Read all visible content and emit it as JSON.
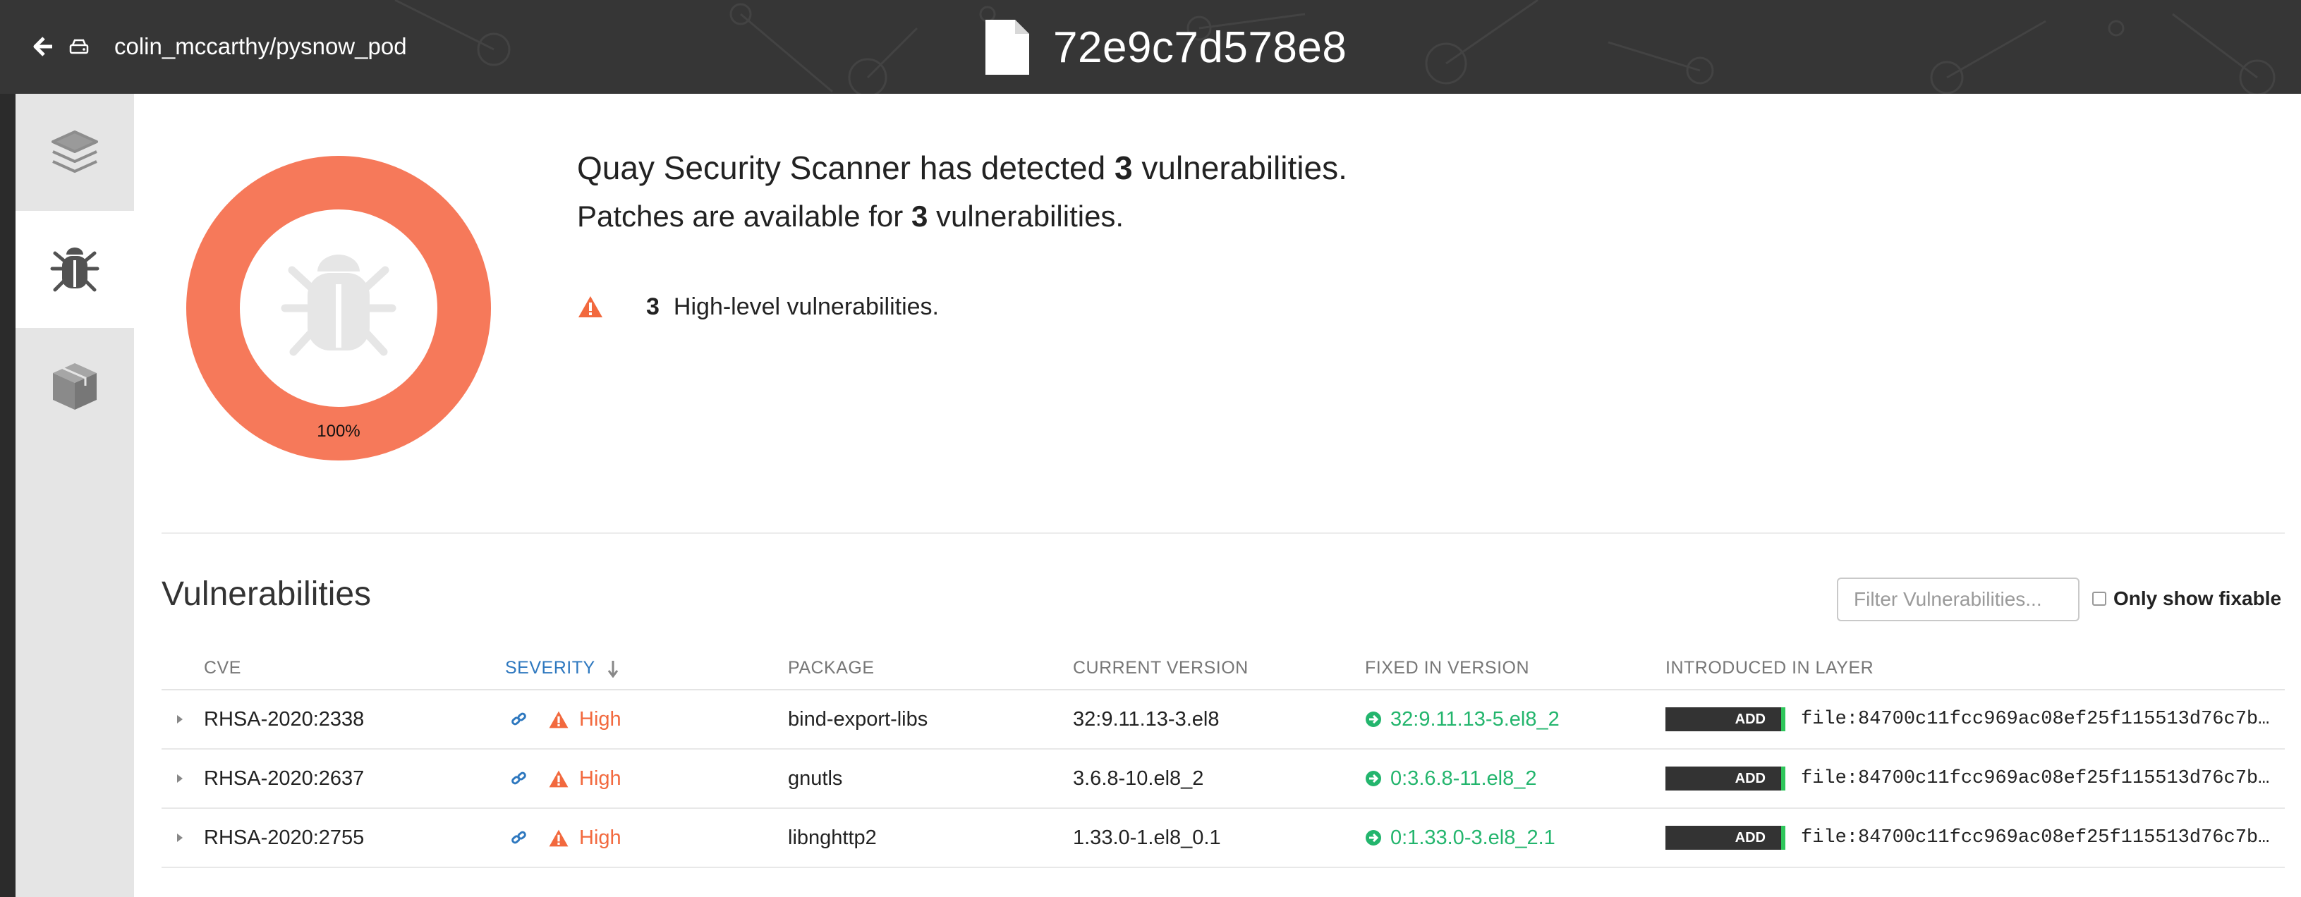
{
  "header": {
    "repository": "colin_mccarthy/pysnow_pod",
    "image_id": "72e9c7d578e8"
  },
  "sidebar": {
    "items": [
      {
        "icon": "layers-icon",
        "label": "Layers"
      },
      {
        "icon": "bug-icon",
        "label": "Security Scan",
        "active": true
      },
      {
        "icon": "package-icon",
        "label": "Packages"
      }
    ]
  },
  "summary": {
    "detected_prefix": "Quay Security Scanner has detected ",
    "detected_count": "3",
    "detected_suffix": " vulnerabilities.",
    "patches_prefix": "Patches are available for ",
    "patches_count": "3",
    "patches_suffix": " vulnerabilities.",
    "high_count": "3",
    "high_label": "High-level vulnerabilities."
  },
  "chart_data": {
    "type": "pie",
    "categories": [
      "High"
    ],
    "values": [
      100
    ],
    "labels": [
      "100%"
    ],
    "center_icon": "bug-icon"
  },
  "vulnerabilities": {
    "title": "Vulnerabilities",
    "filter_placeholder": "Filter Vulnerabilities...",
    "fixable_label": "Only show fixable",
    "columns": [
      "CVE",
      "SEVERITY",
      "PACKAGE",
      "CURRENT VERSION",
      "FIXED IN VERSION",
      "INTRODUCED IN LAYER"
    ],
    "sorted_column": "SEVERITY",
    "rows": [
      {
        "cve": "RHSA-2020:2338",
        "severity": "High",
        "package": "bind-export-libs",
        "current": "32:9.11.13-3.el8",
        "fixed": "32:9.11.13-5.el8_2",
        "layer_badge": "ADD",
        "layer": "file:84700c11fcc969ac08ef25f115513d76c7b…"
      },
      {
        "cve": "RHSA-2020:2637",
        "severity": "High",
        "package": "gnutls",
        "current": "3.6.8-10.el8_2",
        "fixed": "0:3.6.8-11.el8_2",
        "layer_badge": "ADD",
        "layer": "file:84700c11fcc969ac08ef25f115513d76c7b…"
      },
      {
        "cve": "RHSA-2020:2755",
        "severity": "High",
        "package": "libnghttp2",
        "current": "1.33.0-1.el8_0.1",
        "fixed": "0:1.33.0-3.el8_2.1",
        "layer_badge": "ADD",
        "layer": "file:84700c11fcc969ac08ef25f115513d76c7b…"
      }
    ]
  },
  "colors": {
    "header_bg": "#363636",
    "high": "#f6795a",
    "fixed": "#23b56d",
    "sort_active": "#2e78bf"
  }
}
